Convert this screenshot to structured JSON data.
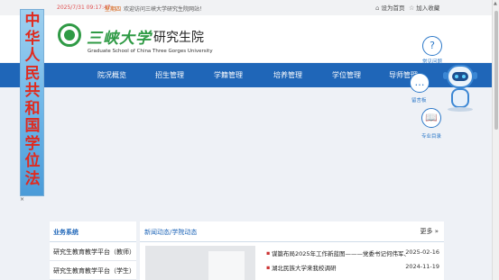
{
  "topbar": {
    "date": "2025/7/31 09:17:47",
    "weekday": "星期四",
    "welcome": "欢迎访问三峡大学研究生院网站！",
    "homepage_icon": "home-icon",
    "homepage_label": "设为首页",
    "favorite_icon": "star-icon",
    "favorite_label": "加入收藏"
  },
  "header": {
    "logo_cn": "三峡大学",
    "logo_suffix": "研究生院",
    "logo_en": "Graduate School of China Three Gorges University"
  },
  "nav": {
    "items": [
      "院况概览",
      "招生管理",
      "学籍管理",
      "培养管理",
      "学位管理",
      "导师管理"
    ]
  },
  "banner": {
    "text": "中华人民共和国学位法",
    "close": "×"
  },
  "sidebar": {
    "title": "业务系统",
    "items": [
      "研究生教育教学平台（教师）",
      "研究生教育教学平台（学生）"
    ]
  },
  "news": {
    "title": "新闻动态/学院动态",
    "more": "更多",
    "items": [
      {
        "title": "谋篇布局2025年工作新蓝图———党委书记何伟军、校",
        "date": "2025-02-16"
      },
      {
        "title": "湖北民族大学来我校调研",
        "date": "2024-11-19"
      }
    ]
  },
  "floating_tools": {
    "faq_icon": "question-icon",
    "faq_label": "常见问题",
    "chat_icon": "chat-bubble-icon",
    "chat_label": "留言板",
    "catalog_icon": "book-icon",
    "catalog_label": "专业目录"
  },
  "colors": {
    "nav_blue": "#1f66b8",
    "logo_green": "#2f9a45",
    "date_red": "#e05050",
    "banner_text_red": "#e02a1e"
  }
}
